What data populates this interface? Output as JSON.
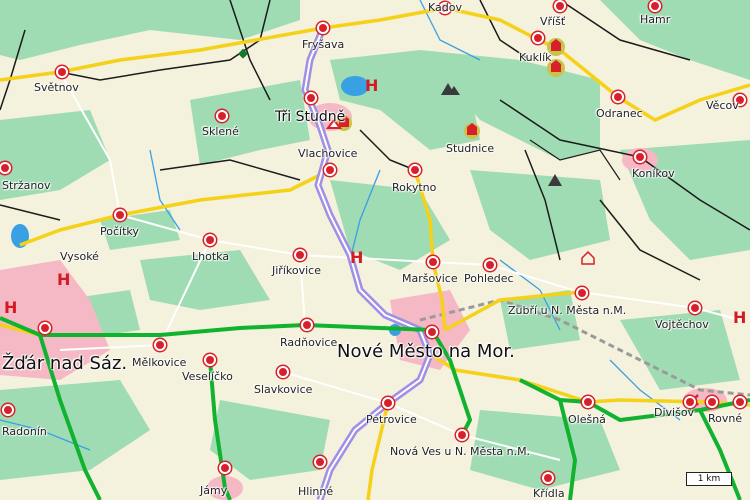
{
  "scale": {
    "label": "1 km"
  },
  "places": [
    {
      "name": "Kadov"
    },
    {
      "name": "Vříšť"
    },
    {
      "name": "Hamr"
    },
    {
      "name": "Fryšava"
    },
    {
      "name": "Kuklík"
    },
    {
      "name": "Světnov"
    },
    {
      "name": "Tři Studně"
    },
    {
      "name": "Sklené"
    },
    {
      "name": "Odranec"
    },
    {
      "name": "Věcov"
    },
    {
      "name": "Vlachovice"
    },
    {
      "name": "Studnice"
    },
    {
      "name": "Stržanov"
    },
    {
      "name": "Rokytno"
    },
    {
      "name": "Koníkov"
    },
    {
      "name": "Počítky"
    },
    {
      "name": "Vysoké"
    },
    {
      "name": "Lhotka"
    },
    {
      "name": "Jiříkovice"
    },
    {
      "name": "Maršovice"
    },
    {
      "name": "Pohledec"
    },
    {
      "name": "Zubří u N. Města n.M."
    },
    {
      "name": "Vojtěchov"
    },
    {
      "name": "Radňovice"
    },
    {
      "name": "Žďár nad Sáz."
    },
    {
      "name": "Mělkovice"
    },
    {
      "name": "Nové Město na Mor."
    },
    {
      "name": "Veselíčko"
    },
    {
      "name": "Slavkovice"
    },
    {
      "name": "Radonín"
    },
    {
      "name": "Petrovice"
    },
    {
      "name": "Olešná"
    },
    {
      "name": "Divišov"
    },
    {
      "name": "Rovné"
    },
    {
      "name": "Nová Ves u N. Města n.M."
    },
    {
      "name": "Jámy"
    },
    {
      "name": "Hlinné"
    },
    {
      "name": "Křídla"
    }
  ],
  "legend_marks": {
    "hospital": "H"
  },
  "colors": {
    "background": "#f4f1dc",
    "forest": "#9fdcb3",
    "town_area": "#f4b9c4",
    "water": "#3aa0e4",
    "motorway": "#11b22f",
    "main_road": "#f5d118",
    "scenic_route": "#9f8fe6",
    "town_marker": "#d8202a"
  },
  "icons": [
    "town-marker-icon",
    "hospital-icon",
    "peak-icon",
    "castle-icon",
    "church-icon",
    "mountain-icon"
  ]
}
